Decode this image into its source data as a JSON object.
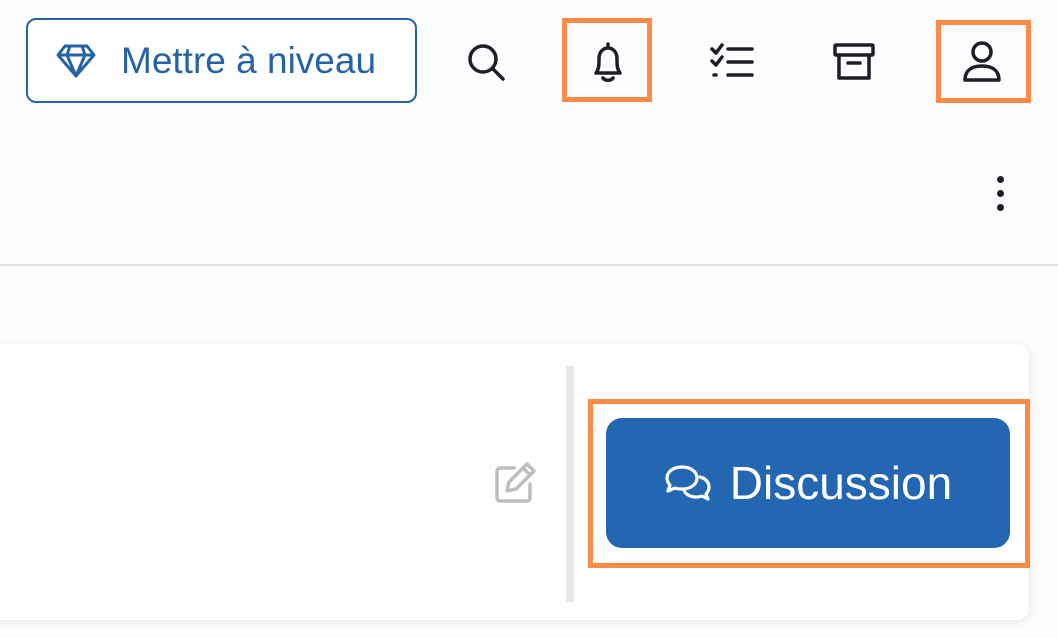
{
  "header": {
    "upgrade_label": "Mettre à niveau",
    "icons": [
      "diamond-icon",
      "search-icon",
      "bell-icon",
      "checklist-icon",
      "archive-icon",
      "user-icon"
    ]
  },
  "toolbar": {
    "more_icon": "kebab-vertical-icon"
  },
  "card": {
    "edit_icon": "edit-icon",
    "discussion_label": "Discussion",
    "discussion_icon": "chat-bubbles-icon"
  },
  "colors": {
    "accent": "#2563a8",
    "button_bg": "#2366b1",
    "highlight": "#ff8a45",
    "background": "#fdfcfe"
  }
}
